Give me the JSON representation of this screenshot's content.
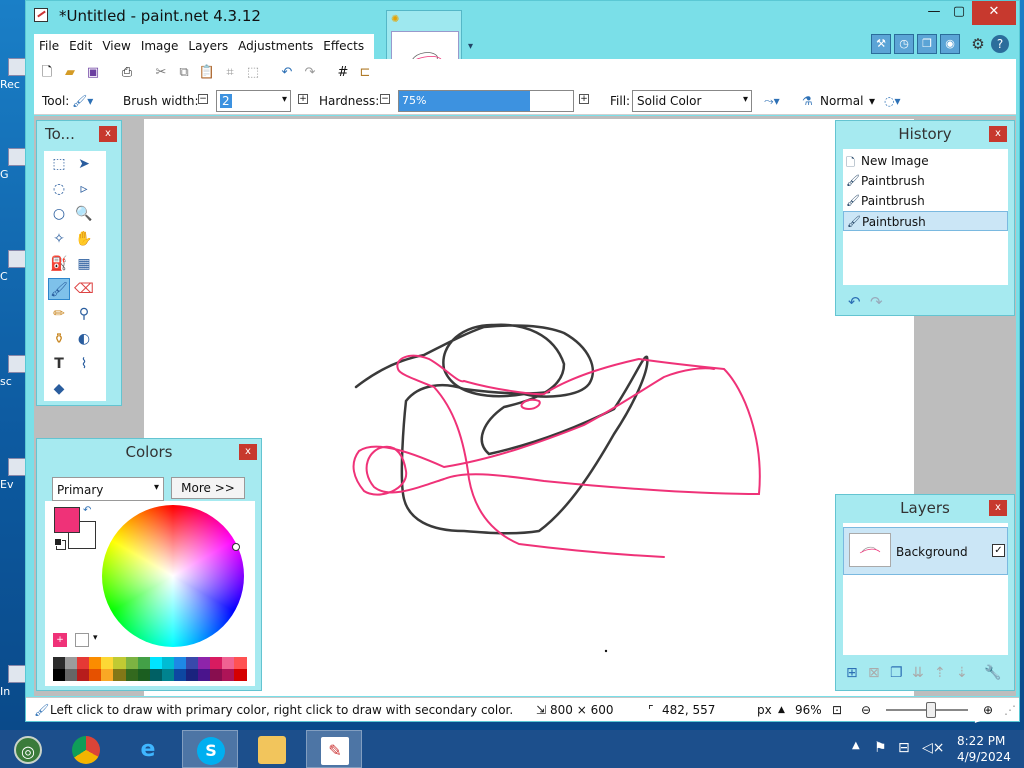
{
  "desktop": {
    "icons": [
      "Rec",
      "G",
      "C",
      "sc",
      "Ev",
      "In"
    ]
  },
  "window": {
    "title": "*Untitled - paint.net 4.3.12",
    "minimize": "—",
    "maximize": "▢",
    "close": "✕"
  },
  "menu": [
    "File",
    "Edit",
    "View",
    "Image",
    "Layers",
    "Adjustments",
    "Effects"
  ],
  "toolbar": {
    "tool_label": "Tool:",
    "brush_width_label": "Brush width:",
    "brush_width_value": "2",
    "hardness_label": "Hardness:",
    "hardness_value": "75%",
    "hardness_fraction": 0.75,
    "fill_label": "Fill:",
    "fill_value": "Solid Color",
    "blend_value": "Normal"
  },
  "tools_panel": {
    "title": "To...",
    "close": "x",
    "selected_tool": "paintbrush-tool"
  },
  "colors_panel": {
    "title": "Colors",
    "close": "x",
    "mode": "Primary",
    "more_button": "More >>",
    "primary_color": "#ef3278",
    "secondary_color": "#ffffff",
    "palette": [
      "#2b2b2b",
      "#9b9b9b",
      "#e53935",
      "#fb8c00",
      "#fdd835",
      "#c0ca33",
      "#7cb342",
      "#43a047",
      "#00e5ff",
      "#00bcd4",
      "#1e88e5",
      "#3949ab",
      "#8e24aa",
      "#d81b60",
      "#f06292",
      "#ff5252",
      "#000000",
      "#666666",
      "#b71c1c",
      "#e65100",
      "#f9a825",
      "#827717",
      "#33691e",
      "#1b5e20",
      "#006064",
      "#00838f",
      "#0d47a1",
      "#1a237e",
      "#4a148c",
      "#880e4f",
      "#ad1457",
      "#d50000"
    ]
  },
  "history_panel": {
    "title": "History",
    "close": "x",
    "items": [
      {
        "label": "New Image",
        "icon": "new-image-icon"
      },
      {
        "label": "Paintbrush",
        "icon": "paintbrush-icon"
      },
      {
        "label": "Paintbrush",
        "icon": "paintbrush-icon"
      },
      {
        "label": "Paintbrush",
        "icon": "paintbrush-icon"
      }
    ],
    "selected_index": 3
  },
  "layers_panel": {
    "title": "Layers",
    "close": "x",
    "layers": [
      {
        "name": "Background",
        "visible": true
      }
    ]
  },
  "status": {
    "hint": "Left click to draw with primary color, right click to draw with secondary color.",
    "image_size": "800 × 600",
    "cursor_pos": "482, 557",
    "units": "px",
    "zoom": "96%"
  },
  "taskbar": {
    "time": "8:22 PM",
    "date": "4/9/2024"
  }
}
